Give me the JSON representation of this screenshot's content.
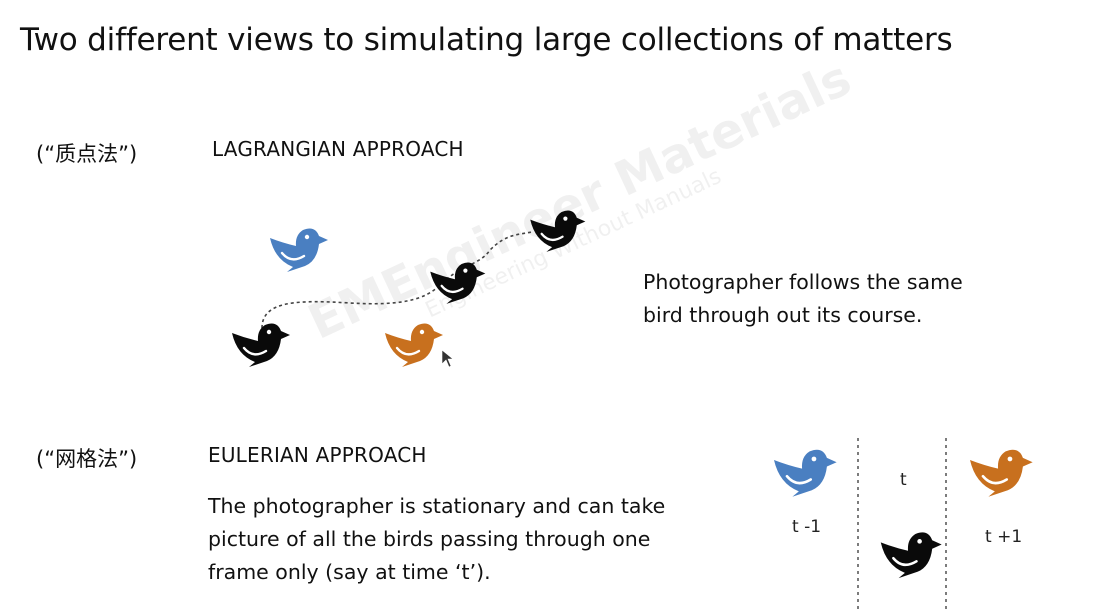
{
  "slide": {
    "title": "Two different views to simulating large collections of matters",
    "lagrangian": {
      "cn_label": "(“质点法”)",
      "heading": "LAGRANGIAN APPROACH",
      "description_line1": "Photographer follows the same",
      "description_line2": "bird through out its course."
    },
    "eulerian": {
      "cn_label": "(“网格法”)",
      "heading": "EULERIAN APPROACH",
      "description_line1": "The photographer is stationary and can take",
      "description_line2": "picture of all the birds passing through one",
      "description_line3": "frame only (say at time  ‘t’).",
      "label_t_minus": "t -1",
      "label_t": "t",
      "label_t_plus": "t +1"
    },
    "watermark": {
      "line1": "EMEngineer Materials",
      "line2": "Engineering Without Manuals"
    }
  },
  "colors": {
    "bird_blue": "#4a7fc1",
    "bird_orange": "#c8701e",
    "bird_black": "#0a0a0a"
  }
}
